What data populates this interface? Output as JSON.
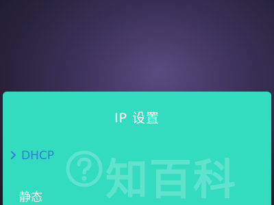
{
  "dialog": {
    "title": "IP 设置",
    "options": [
      {
        "label": "DHCP",
        "selected": true
      },
      {
        "label": "静态",
        "selected": false
      }
    ]
  },
  "watermark": {
    "text": "知百科",
    "icon": "question-badge-icon"
  },
  "colors": {
    "dialog_background": "#33dbbf",
    "selected_option": "#2f7fd8",
    "text": "#ffffff",
    "backdrop": "#3f3660"
  },
  "icons": {
    "selection_indicator": "chevron-right-icon"
  }
}
